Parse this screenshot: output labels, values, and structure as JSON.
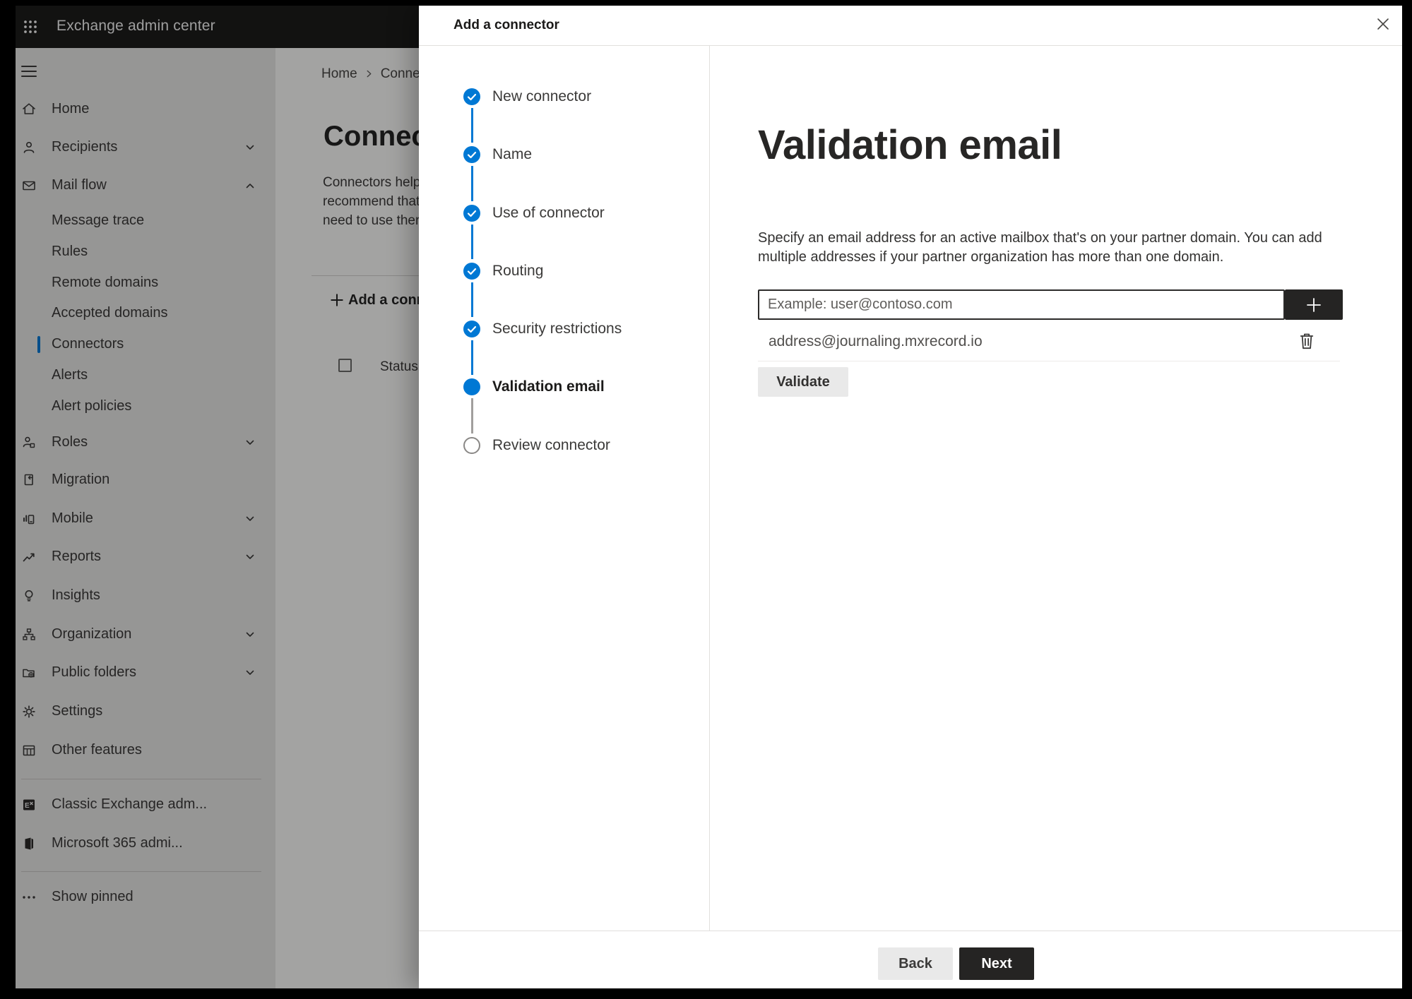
{
  "app": {
    "title": "Exchange admin center"
  },
  "sidebar": {
    "items": [
      {
        "label": "Home",
        "icon": "home",
        "type": "main"
      },
      {
        "label": "Recipients",
        "icon": "person",
        "type": "main",
        "chevron": "down"
      },
      {
        "label": "Mail flow",
        "icon": "mail",
        "type": "main",
        "chevron": "up"
      },
      {
        "label": "Message trace",
        "type": "sub"
      },
      {
        "label": "Rules",
        "type": "sub"
      },
      {
        "label": "Remote domains",
        "type": "sub"
      },
      {
        "label": "Accepted domains",
        "type": "sub"
      },
      {
        "label": "Connectors",
        "type": "sub",
        "selected": true
      },
      {
        "label": "Alerts",
        "type": "sub"
      },
      {
        "label": "Alert policies",
        "type": "sub"
      },
      {
        "label": "Roles",
        "icon": "roles",
        "type": "main",
        "chevron": "down"
      },
      {
        "label": "Migration",
        "icon": "migration",
        "type": "main"
      },
      {
        "label": "Mobile",
        "icon": "mobile",
        "type": "main",
        "chevron": "down"
      },
      {
        "label": "Reports",
        "icon": "reports",
        "type": "main",
        "chevron": "down"
      },
      {
        "label": "Insights",
        "icon": "insights",
        "type": "main"
      },
      {
        "label": "Organization",
        "icon": "organization",
        "type": "main",
        "chevron": "down"
      },
      {
        "label": "Public folders",
        "icon": "public-folders",
        "type": "main",
        "chevron": "down"
      },
      {
        "label": "Settings",
        "icon": "settings",
        "type": "main"
      },
      {
        "label": "Other features",
        "icon": "other-features",
        "type": "main"
      }
    ],
    "footer_items": [
      {
        "label": "Classic Exchange adm...",
        "icon": "classic-exchange"
      },
      {
        "label": "Microsoft 365 admi...",
        "icon": "m365"
      }
    ],
    "show_pinned": {
      "label": "Show pinned",
      "icon": "ellipsis"
    }
  },
  "background": {
    "breadcrumb": [
      "Home",
      "Conne"
    ],
    "page_heading": "Connec",
    "paragraph_lines": [
      "Connectors help",
      "recommend that",
      "need to use ther"
    ],
    "add_button": "Add a conn",
    "column_header": "Status"
  },
  "modal": {
    "title": "Add a connector",
    "steps": [
      {
        "label": "New connector",
        "state": "done"
      },
      {
        "label": "Name",
        "state": "done"
      },
      {
        "label": "Use of connector",
        "state": "done"
      },
      {
        "label": "Routing",
        "state": "done"
      },
      {
        "label": "Security restrictions",
        "state": "done"
      },
      {
        "label": "Validation email",
        "state": "current"
      },
      {
        "label": "Review connector",
        "state": "upcoming"
      }
    ],
    "heading": "Validation email",
    "description_lines": [
      "Specify an email address for an active mailbox that's on your partner domain. You can add",
      "multiple addresses if your partner organization has more than one domain."
    ],
    "email_input_placeholder": "Example: user@contoso.com",
    "added_addresses": [
      "address@journaling.mxrecord.io"
    ],
    "validate_button": "Validate",
    "back_button": "Back",
    "next_button": "Next"
  },
  "colors": {
    "accent": "#0078d4",
    "dark_button": "#252423",
    "step_upcoming_border": "#8a8886",
    "step_pending_line": "#a19f9d"
  }
}
